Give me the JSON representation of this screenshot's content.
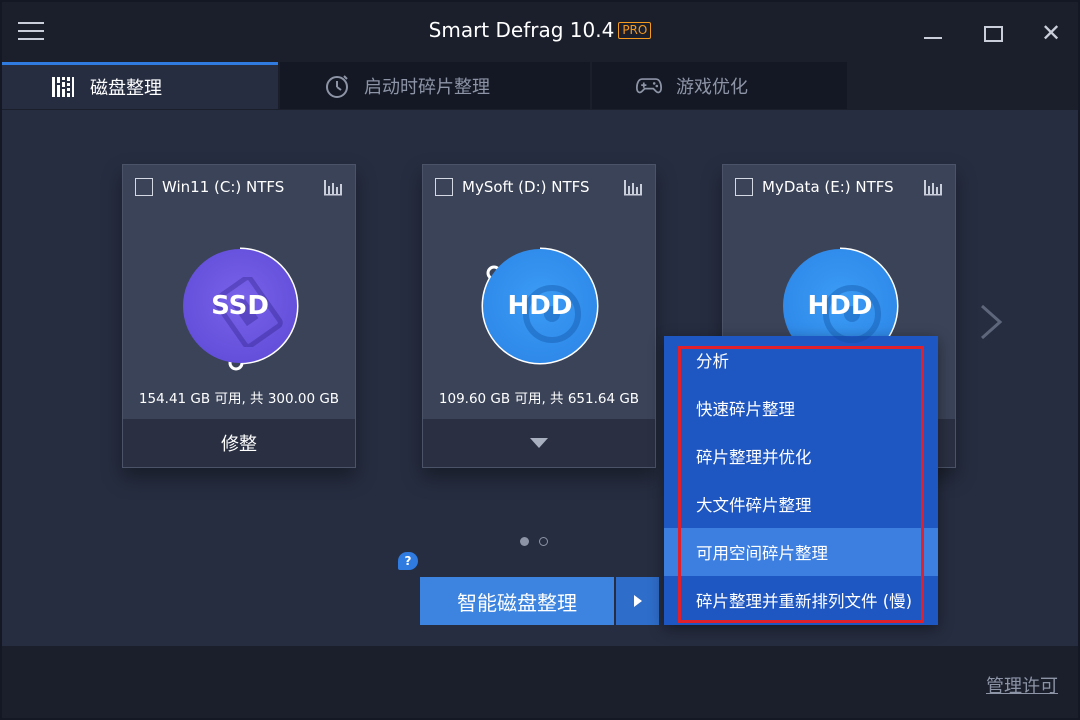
{
  "app": {
    "title": "Smart Defrag 10.4",
    "edition_badge": "PRO"
  },
  "tabs": [
    {
      "label": "磁盘整理",
      "icon": "defrag-bars-icon",
      "active": true
    },
    {
      "label": "启动时碎片整理",
      "icon": "stopwatch-icon",
      "active": false
    },
    {
      "label": "游戏优化",
      "icon": "gamepad-icon",
      "active": false
    }
  ],
  "drives": [
    {
      "name": "Win11 (C:) NTFS",
      "type": "SSD",
      "usage": "154.41 GB 可用, 共 300.00 GB",
      "action": "修整",
      "checked": false,
      "used_fraction": 0.49
    },
    {
      "name": "MySoft (D:) NTFS",
      "type": "HDD",
      "usage": "109.60 GB 可用, 共 651.64 GB",
      "action": "",
      "checked": false,
      "used_fraction": 0.83
    },
    {
      "name": "MyData (E:) NTFS",
      "type": "HDD",
      "usage": "",
      "action": "",
      "checked": false,
      "used_fraction": 0.62
    }
  ],
  "main_button": {
    "label": "智能磁盘整理",
    "help": "?"
  },
  "dropdown": {
    "items": [
      "分析",
      "快速碎片整理",
      "碎片整理并优化",
      "大文件碎片整理",
      "可用空间碎片整理",
      "碎片整理并重新排列文件 (慢)"
    ],
    "hovered_index": 4
  },
  "footer": {
    "license_link": "管理许可"
  },
  "colors": {
    "accent": "#2f7be0",
    "ssd": "#6a55e0",
    "hdd": "#2f8ff0",
    "highlight": "#e0202a",
    "pro_badge": "#f39a1f"
  }
}
